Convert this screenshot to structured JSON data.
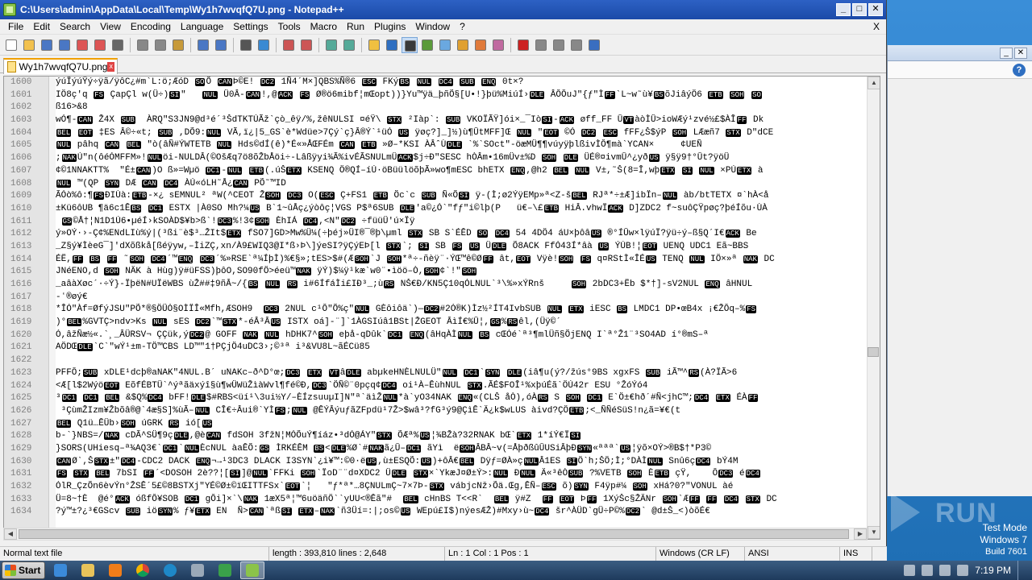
{
  "window": {
    "title": "C:\\Users\\admin\\AppData\\Local\\Temp\\Wy1h7wvqfQ7U.png - Notepad++",
    "minimize": "_",
    "maximize": "□",
    "close": "✕"
  },
  "menu": {
    "items": [
      "File",
      "Edit",
      "Search",
      "View",
      "Encoding",
      "Language",
      "Settings",
      "Tools",
      "Macro",
      "Run",
      "Plugins",
      "Window",
      "?"
    ],
    "close": "X"
  },
  "toolbar": {
    "icons": [
      "new-file-icon",
      "open-file-icon",
      "save-icon",
      "save-all-icon",
      "close-icon",
      "close-all-icon",
      "print-icon",
      "cut-icon",
      "copy-icon",
      "paste-icon",
      "undo-icon",
      "redo-icon",
      "find-icon",
      "replace-icon",
      "zoom-in-icon",
      "zoom-out-icon",
      "sync-v-icon",
      "sync-h-icon",
      "word-wrap-icon",
      "all-chars-icon",
      "indent-guide-icon",
      "udl-icon",
      "doc-map-icon",
      "function-list-icon",
      "folder-workspace-icon",
      "monitor-icon",
      "record-macro-icon",
      "stop-macro-icon",
      "play-macro-icon",
      "run-macro-icon",
      "save-macro-icon"
    ]
  },
  "tab": {
    "label": "Wy1h7wvqfQ7U.png",
    "close": "x"
  },
  "editor": {
    "line_numbers": [
      "1600",
      "1601",
      "1602",
      "1603",
      "1604",
      "1605",
      "1606",
      "1607",
      "1608",
      "1609",
      "1610",
      "1611",
      "1612",
      "1613",
      "1614",
      "1615",
      "1616",
      "1617",
      "1618",
      "1619",
      "1620",
      "1621",
      "1622",
      "1623",
      "1624",
      "1625",
      "1626",
      "1627",
      "1628",
      "1629",
      "1630",
      "1631",
      "1632",
      "1633",
      "1634"
    ],
    "lines": [
      "ýúÏýúŸý÷ÿã/ÿôC¿#m`L:ö;ÆóD SOÕ CANÞ©E! DC2 1Ñ4´M×]QBS%Ñ®6 ESC FKýBS NUL DC4 SUB ENQ 0t×?",
      "IÖ8ç'q FS ÇapÇl w(Ü÷)SI\"   NUL Ü0Â-CAN!,@ACK FS Ø®ö6mibf¦mŒopt))}Yu™ÿä_þñÕ§[U•!}þü%MiúÍ›DLE ÂÔÔuJ\"{ƒ\"ÌFF`L~w˜ù¥BSõJiâýÖ6 ETB SOH SO",
      "ß16>&8",
      "wÓ¶-CAN Ž4X SUB  ÀRQ\"S3JN9@d³é´³ŠdTKTÚÃž`çò_êÿ/%,žêNULSI ¤éŸ\\ STX ²Iàp`: SUB VKOÏÃŸ]ói×_¯IòSI-ACK øff_FF ÛVTàòÌÛ>ioWÆý¹zvé½£$ÀÎFF Dk",
      "BEL EOT ‡ES Â©÷«t; SUB ,DÕ9:NUL VÃ,ï¿|5_GS`è*Wdüe>7Çý`ç}Â®Ý`¹üÓ US ÿøç?]_]½)ù¶ÛtMFF]Œ NUL \"EOT ©Ó DC2 ESC fFF¿Š$ýP SOH LÆæñ7 STX D\"dCE",
      "NUL pâhq CAN BEL \"ò(âÑ#ÝWTETB NUL Hds©dÍ(ê)*É«»ÅŒFÉm CAN ETB »Ø–*KSI ÀÂˆÙDLE `%`SOct\"-öæMÜ¶¶vúyÿþlßivÌÔ¶mà`YCAN×     ¢UEÑ",
      ";NAKÚ\"n(ôéÓMFFM»!NULöi-NULDÂ(©OšÆq7ö8õŽbÅöi÷-Lâßÿyi¾Ã%ivÉÃSNULmÜACK$j÷Ð\"SESC hÒÂm•16mÜv±%D SOH DLE ÜÉ®¤ivmÛ^¿yðUS ÿ§ÿ9†°Ût?ÿöÜ",
      "¢©1NNAKTT%  \"É±CAN)O ß»=Wµö DC1-NUL ETB(.úŠETX KSENQ Ö®QÍ–íÚ·öBüülöõþÃ»wo¶mESC bhETX ENQ,@h2 BEL NUL V±,˜Š(8=Î,wþETX SI NUL ×PÚETX à",
      "NUL ™(QP SYN DÆ CAN DC4 ÀÚ«óLH˜Å¿CAN PÕ˜™ID",
      "ÃÓò%ô:¶FSÐIÙà:ETB-×¿ sEMNUL² ªW(^CEOT ŽSOH DC3 O(ESC Ç+FS1 ETB Ö̃c`c SUB Ñ«ÕSI ÿ-(Ì;ø2ÝÿEMp»ª<Z-šBEL RJª*÷±Æ]ibÏn–NUL àb/btTETX ¤`hÀ<å",
      "±Kü6ôUB ¶ä6c1ÊBS DC1 ESTX |À0SO Mh?¼US B`1~ûÅç¿ýòôç¦VGS P$ª6SUB DLE'a©¿Ó`\"fƒ\"i©lþ(P   ü€–\\£ETB HiÂ.vhwÏACK D]ZDC2 f~suôÇŸpøç?þéÍõu·ÙÀ",
      " GS©Å†¦N1D1Ú6•µéÍ›kSOÀD$¥b>ß`!DC3%!3¢SOH ÈhIÁ DC4,<N\"DC2 ÷füüÜ'ú×Ïÿ",
      "ý»OÝ·›-Ç¢%ENdLIù%ý|(³ßi¨è$³…ŽIt$ETX fSO7]GD>Mw%Ü¼(÷þéj»ÜI®¯®þ\\µml STX SB S`ÉÊD SO DC4 54 4DÖ4 áU×þôâUS ®°ÍÛw×lÿúÏ?ÿü÷ý–ß§Q´I€ACK Be",
      "_Z§ý¥ÌèeG¯]'dXõßkå[ßéÿyw,–ÌiZÇ,xn/À9£WIQ3@I*ß›Þ\\]ýeSI?ÿÇýEÞ[l STX`; SI SB FS US ÜDLE Õ8ACK FfÓ43Í*âà US ÝÚB!¦EOT UENQ UDC1 Eã~BBS",
      "ÉË,FF BS FF ˜SOH DC4´™ENQ DC3´%»RSE`ª¼ÍþÌ)%€§»;tES>$#(ÆSOH`J SOH*ª÷-ñèÿ¨·ÝŒ™ê©ØFF ât,EOT Vÿè!SOH FS q¤RStÌ«ÎÉUS TENQ NUL IÖ×»ª NAK DC",
      "JNéENO,d SOH NÄK à Hùg)ÿ#üFSS)þôO,SO90fÖ>éeü™NAK ÿÝ)$¼ÿ¹kæ`w0¨•ìöö–Ò,SOH¢`!\"SOH",
      "_aâàXøc´·÷Ý}-ÏþëN#UÏëWBS ùŽ##‡9ñÂ~/{BS NUL RS i#6ÍfáÌi£IÐ³_;ùRS NŠ€Ð/KN5Ç10qÓLNUL`³\\%»xÝRnš     SOH 2bDC3+Ëb $*†]-sV2NUL ENQ âHNUL",
      "-ʻ®øý€",
      "*ÎÓ\"Àf=ØfýJSU\"PÕ*®§ÖÜÓ§OÌÏÎ«Mfh,ÆSOH9  DC3 2NUL c¹Ô\"Õ%ç\"NUL GÈôiôä`)—DC2#2Ó®K)Ìz½²ÍT4IvbSUB NUL ETX iESC BS LMDC1 DP•œB4x ¡€ŽÔq–%FS",
      ")°BEL%GVTÇ>ndv>Ks NUL sES DC2`™STX*-éÂ³ÂUS ISTX oá]-¨]`1ÀGSIúâ1BSt|ŽGEOT ÂìÍ€%Û¦,GS%RSêl,(Üÿ©´",
      "Ó,âžÑæ½«.`¸_ÂÜRSV¬ ÇÇük,ýDC2@ GOFF NAK NUL hDHK7^SOH eþå-qDûk`DC1 ENQ(âHqÀÌNUL BS cŒÓé`ª³¶mlÜñ§ÕjENQ I`ª°Ž1¨³SO4AD í°®mS–ª",
      "AÖDŒDLE`C`\"wÝ¹±m-TÖ™CBS LD™\"1†PÇjÖ4uDC3›;©³ª i³&VU8L~ãÉCü85",
      "",
      "PFFÔ;SUB xDLE¹dcþ®aNAK\"4NUL.B´ uNAKc–ð^D°œ;DC3 ETX VTâDLE abµkeHNÈLNULÜ\"NUL DC1`SYN DLE(iâ¶u(ý?/žús°9BS xgxFS SUB iÃ™^RS(À?ÏÃ>6",
      "<Æ[l$2WýöEOT EõfÉBTÜ`^ýªãäxýî§ù¶wÜWüŽìàWvl¶fé©Ð,DC3`ÖÑ©¨0pçq¢DC4 oi¹À–ÊùhNUL STX.ÃÉ$FOÎ¹%xþúÉã`ÖÚ42r ESU °ŽóÝó4",
      "³DC1 DC1 BEL &$Q%DC4 bFF!DLE$#RBS<üí¹\\3ui½Y/–ÈÍzsuuµI]N\"ª`äìŽNUL*à`yO34NAK ENQ«(CLŠ åÒ),óÀRS S SOH DC1 E`Ö±€hð´#Ñ<jhC™;DC4 ETX ÉÀFF",
      " ³ÇùmŽIzm¥Žbõâ®@`4æ§S]%ùÃ–NUL CÎ€÷Âui®`YÌFS;NUL @ÊÝÂýuƒãZFpdü¹7Ž>$wâ³?fG³ý9@ÇìÊ`Ä¿k$wLUS àivd?ÇÖETB;<_ÑÑéSüS!n¿ã=¥€(t",
      "BEL Q1ü…ÊÜb›SOH úGRK RS ió[US",
      "b-`}NBS=/NAK cDÃ^SÜ¶9çDLE,@èCAN fdSOH 3fžN¦MÓÕuÝ¶íáz•³dÓ@ÁY\"STX ÕÆª%US¦¾BŽà?32RNAK bŒ`ETX 1*íÝ€ÏSI",
      "}SORS(UHiesq–ª¾AQ3€`DC1`NULÈcNUL àaÊÕ:GS ÌRKÉÊM BS<DLE%Ø`#NAKã¿Û–DC1 ãYì  ëSOHÂBÂ~v(=ÅþðßûÛUSiÂþÐSYN«ªªª`US¦ÿõ×OÝ>®B$†*P3©",
      "CANØ`,ŠSTX±\"DC4-CDC2 DACK ENQ¬→¹3DC3 DLACK I3SYN`¿i¥™:©0·ëUS,ù±ESQÕ:US)+ôÂ€BEL Dÿƒ=ØÀ»çNULÂ1ES SIÖ`h;ŠÖ;Ì;°DÀÌNUL Snû6çDC4 bÝ4M",
      "FS STX BEL 7bSI FF´<DOSOH 2è??¦[SI]@NUL`FFKi SOH`ÏoD¨¨d¤XDC2 ÜDLE STX×`YkæJ¤Ø±Ý>:NUL ÐNUL Ä«³êÒSUB ?%VETB SOH ÈETB çŸ,    ÔDC3 éDC4",
      "ÓlR_ÇzÕn6èvÝn°ŽSÊ´5£©8BSTXj\"YÉ©Ø±©ïŒITTFSx`EOT`¦   \"ƒ*ª*…8ÇNULmÇ~7×7Þ-STX vábjcNž›Õä.Œg,ÊÑ–ESC õ)SYN F4ÿp#¼ SOH xHá?0?\"VONUL àé",
      "Ü=8~†È  @é°ACK óßfÔ¥SOB DC1 gÔi]×`\\NAK 1æX5ª¦™6uöäñÖ``yUU<®Êã\"#  BEL cHnBS T<<R`  BEL ÿ#Z  FF EOT ÞFF 1XýŠc§ŽÄNr SOH`ÆFF FF DC4 STX DC",
      "?ý™±?¿³€GScv SUB iöSYN% ƒ¥ETX EN  Ñ>CAN`ªßSI ETX–NAK`ñ3Üí=:|;os©US WEpú£I$)nýesÆŽ)#Mxy›ù~DC4 šr^ÀÜD`gÜ÷P©%DC2` @d±Š_<)òõÉ€"
    ]
  },
  "statusbar": {
    "type": "Normal text file",
    "length": "length : 393,810    lines : 2,648",
    "position": "Ln : 1    Col : 1    Pos : 1",
    "eol": "Windows (CR LF)",
    "encoding": "ANSI",
    "mode": "INS"
  },
  "desktop": {
    "watermark": "RUN",
    "test_mode_line1": "Test Mode",
    "test_mode_line2": "Windows 7",
    "test_mode_line3": "Build 7601"
  },
  "taskbar": {
    "start_label": "Start",
    "clock": "7:19 PM"
  },
  "colors": {
    "titlebar": "#2d61c4",
    "tab_accent": "#f0a000",
    "control_char_bg": "#000000",
    "taskbar": "#2b4a6e"
  }
}
